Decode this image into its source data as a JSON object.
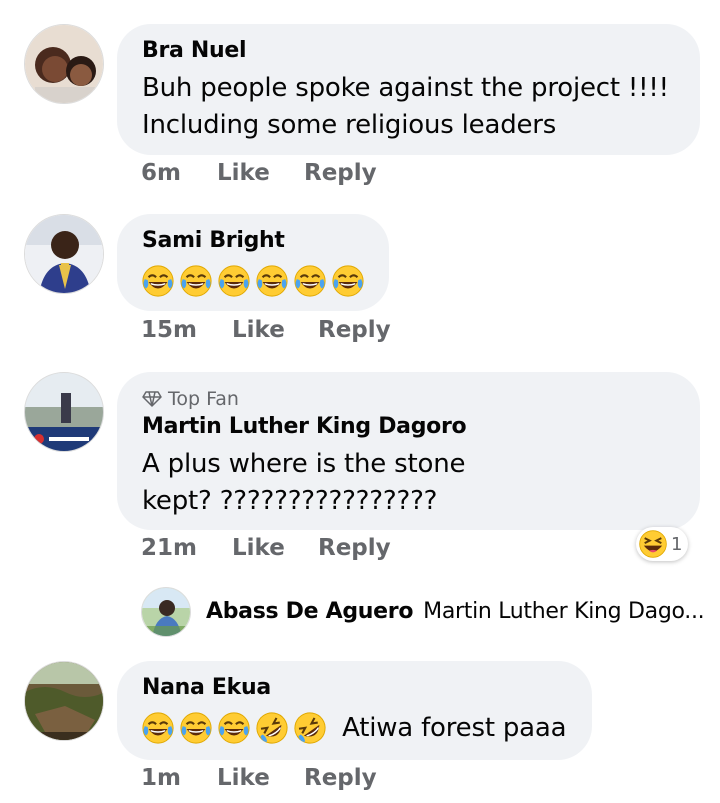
{
  "comments": [
    {
      "author": "Bra Nuel",
      "lines": [
        "Buh people spoke against the project !!!!",
        "Including some religious leaders"
      ],
      "time": "6m",
      "like": "Like",
      "reply": "Reply"
    },
    {
      "author": "Sami Bright",
      "emojis": [
        "joy",
        "joy",
        "joy",
        "joy",
        "joy",
        "joy"
      ],
      "time": "15m",
      "like": "Like",
      "reply": "Reply"
    },
    {
      "badge": "Top Fan",
      "author": "Martin Luther King Dagoro",
      "lines": [
        "A plus where is the stone",
        "kept? ????????????????"
      ],
      "time": "21m",
      "like": "Like",
      "reply": "Reply",
      "reaction": {
        "icon": "laugh-reaction-icon",
        "count": "1"
      }
    },
    {
      "author": "Nana Ekua",
      "emojis": [
        "joy",
        "joy",
        "joy",
        "rofl",
        "rofl"
      ],
      "text_after_emojis": "Atiwa forest paaa",
      "time": "1m",
      "like": "Like",
      "reply": "Reply"
    }
  ],
  "reply_preview": {
    "author": "Abass De Aguero",
    "snippet": "Martin Luther King Dago..."
  },
  "colors": {
    "bubble": "#f0f2f5",
    "secondary_text": "#65676b",
    "emoji_face": "#ffcc33",
    "tears": "#4aa3f0"
  }
}
